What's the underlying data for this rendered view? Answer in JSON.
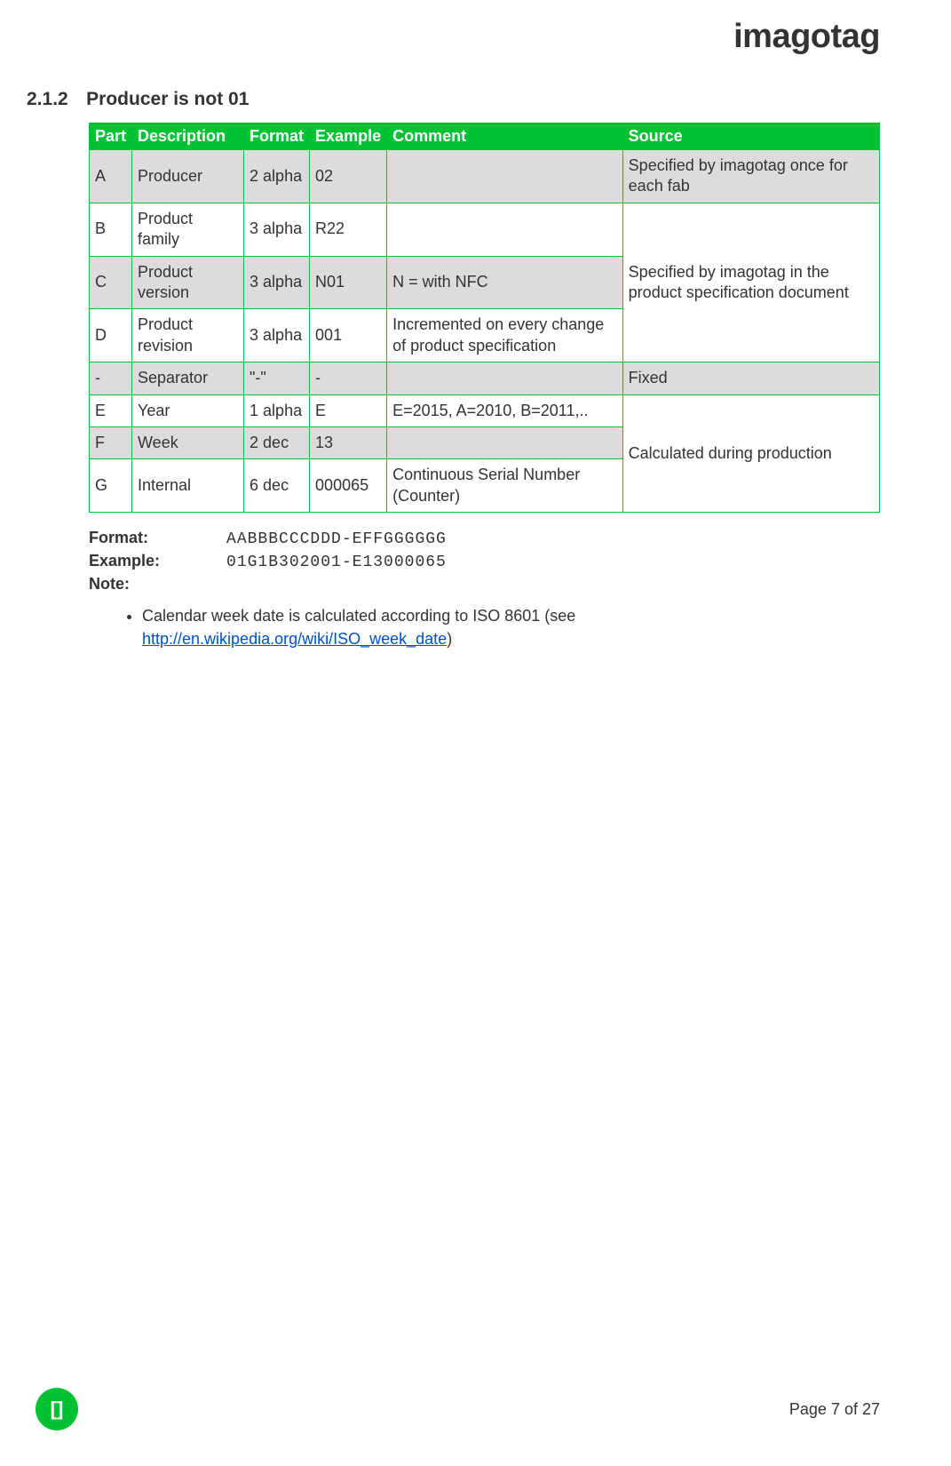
{
  "brand": "imagotag",
  "section_number": "2.1.2",
  "section_title": "Producer is not 01",
  "table": {
    "headers": [
      "Part",
      "Description",
      "Format",
      "Example",
      "Comment",
      "Source"
    ],
    "rows": [
      {
        "part": "A",
        "desc": "Producer",
        "fmt": "2 alpha",
        "ex": "02",
        "cmt": "",
        "src": "Specified by imagotag once for each fab",
        "src_span": 1,
        "shade": "grey"
      },
      {
        "part": "B",
        "desc": "Product family",
        "fmt": "3 alpha",
        "ex": "R22",
        "cmt": "",
        "src": "Specified by imagotag in the product specification document",
        "src_span": 3,
        "shade": "white"
      },
      {
        "part": "C",
        "desc": "Product version",
        "fmt": "3 alpha",
        "ex": "N01",
        "cmt": "N = with NFC",
        "shade": "grey"
      },
      {
        "part": "D",
        "desc": "Product revision",
        "fmt": "3 alpha",
        "ex": "001",
        "cmt": "Incremented on every change of product specification",
        "shade": "white"
      },
      {
        "part": "-",
        "desc": "Separator",
        "fmt": "\"-\"",
        "ex": "-",
        "cmt": "",
        "src": "Fixed",
        "src_span": 1,
        "shade": "grey"
      },
      {
        "part": "E",
        "desc": "Year",
        "fmt": "1 alpha",
        "ex": "E",
        "cmt": "E=2015, A=2010, B=2011,..",
        "src": "Calculated during production",
        "src_span": 3,
        "shade": "white"
      },
      {
        "part": "F",
        "desc": "Week",
        "fmt": "2 dec",
        "ex": "13",
        "cmt": "",
        "shade": "grey"
      },
      {
        "part": "G",
        "desc": "Internal",
        "fmt": "6 dec",
        "ex": "000065",
        "cmt": "Continuous Serial Number (Counter)",
        "shade": "white"
      }
    ]
  },
  "format_label": "Format:",
  "format_value": "AABBBCCCDDD-EFFGGGGGG",
  "example_label": "Example:",
  "example_value": "01G1B302001-E13000065",
  "note_label": "Note:",
  "note_text_prefix": "Calendar week date is calculated according to ISO 8601 (see ",
  "note_link": "http://en.wikipedia.org/wiki/ISO_week_date",
  "note_text_suffix": ")",
  "footer_badge": "[]",
  "footer_page": "Page 7 of 27"
}
